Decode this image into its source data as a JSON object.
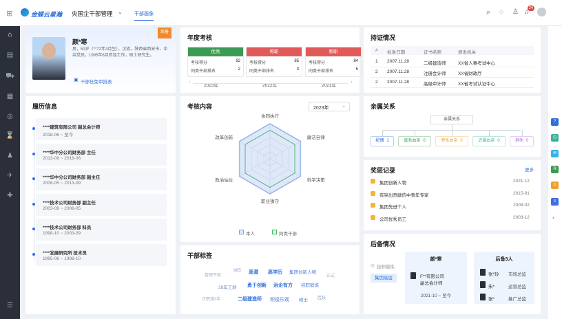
{
  "header": {
    "brand": "金蝶云星瀚",
    "menu": "央国企干部管理",
    "tab": "干部画像",
    "notification_count": "24"
  },
  "profile": {
    "name": "颜*寒",
    "badge": "后备",
    "bio": "男，51岁（**72年4月生），汉族，陕西省西安市，中共党员，1995年6月参加工作，硕士研究生。",
    "link": "干部任免审批表"
  },
  "resume": {
    "title": "履历信息",
    "items": [
      {
        "org": "****建筑有限公司   副总会计师",
        "period": "2018-06 ~ 至今"
      },
      {
        "org": "****华中分公司财务部   主任",
        "period": "2013-09 ~ 2018-06"
      },
      {
        "org": "****华中分公司财务部   副主任",
        "period": "2008-05 ~ 2013-09"
      },
      {
        "org": "****技术公司财务部   副主任",
        "period": "2003-09 ~ 2008-05"
      },
      {
        "org": "****技术公司财务部   科员",
        "period": "1998-10 ~ 2003-09"
      },
      {
        "org": "****发展研究所   技术员",
        "period": "1995-06 ~ 1998-10"
      }
    ]
  },
  "annual": {
    "title": "年度考核",
    "boxes": [
      {
        "grade": "优秀",
        "color": "#3d9a54",
        "score_label": "考核得分",
        "score": "92",
        "rank_label": "同类干部排名",
        "rank": "2",
        "year": "2023年"
      },
      {
        "grade": "称职",
        "color": "#e05a5a",
        "score_label": "考核得分",
        "score": "85",
        "rank_label": "同类干部排名",
        "rank": "3",
        "year": "2022年"
      },
      {
        "grade": "称职",
        "color": "#e05a5a",
        "score_label": "考核得分",
        "score": "84",
        "rank_label": "同类干部排名",
        "rank": "5",
        "year": "2021年"
      }
    ]
  },
  "assessment": {
    "title": "考核内容",
    "year_select": "2023年",
    "axes": [
      "协同执行",
      "廉洁自律",
      "科学决策",
      "职业操守",
      "政治站位",
      "改革创新"
    ],
    "legend": [
      "本人",
      "同类干部"
    ],
    "self_color": "#7aa2e8",
    "peer_color": "#49b96a"
  },
  "tags": {
    "title": "干部标签",
    "items": [
      "管理干部",
      "985",
      "高潜",
      "高学历",
      "集团创新人物",
      "正式",
      "28年工龄",
      "勇于创新",
      "治企有方",
      "挂职锻炼",
      "正职满3年",
      "二级建造师",
      "积极乐观",
      "硕士",
      "活跃"
    ]
  },
  "certs": {
    "title": "持证情况",
    "headers": [
      "#",
      "批准日期",
      "证书名称",
      "颁发机关"
    ],
    "rows": [
      [
        "1",
        "2007.11.28",
        "二级建造师",
        "XX省人事考试中心"
      ],
      [
        "2",
        "2007.11.28",
        "注册会计师",
        "XX省财政厅"
      ],
      [
        "2",
        "2007.11.28",
        "高级审计师",
        "XX省考试认证中心"
      ]
    ]
  },
  "relatives": {
    "title": "亲属关系",
    "root": "亲属关系",
    "items": [
      {
        "label": "配偶",
        "count": "1",
        "color": "#2f6fd8"
      },
      {
        "label": "直系血亲",
        "count": "0",
        "color": "#3d9a54"
      },
      {
        "label": "旁系血亲",
        "count": "0",
        "color": "#e6a23c"
      },
      {
        "label": "近姻血亲",
        "count": "0",
        "color": "#3bb39c"
      },
      {
        "label": "其他",
        "count": "0",
        "color": "#a86fd8"
      }
    ]
  },
  "awards": {
    "title": "奖惩记录",
    "more": "更多",
    "items": [
      {
        "name": "集团创新人物",
        "date": "2021-12"
      },
      {
        "name": "有突出贡献的中青年专家",
        "date": "2015-01"
      },
      {
        "name": "集团先进个人",
        "date": "2009-02"
      },
      {
        "name": "公司优秀员工",
        "date": "2003-12"
      }
    ]
  },
  "succession": {
    "title": "后备情况",
    "option_label": "挂职锻炼",
    "button": "集团高层",
    "person": "颜*寒",
    "person_org": "F**有限公司",
    "person_role": "副总会计师",
    "person_period": "2021-10 ~ 至今",
    "reserve_title": "后备3人",
    "reserves": [
      {
        "name": "张*玲",
        "role": "市场总监"
      },
      {
        "name": "朱*",
        "role": "运营总监"
      },
      {
        "name": "张*",
        "role": "推广总监"
      }
    ]
  }
}
